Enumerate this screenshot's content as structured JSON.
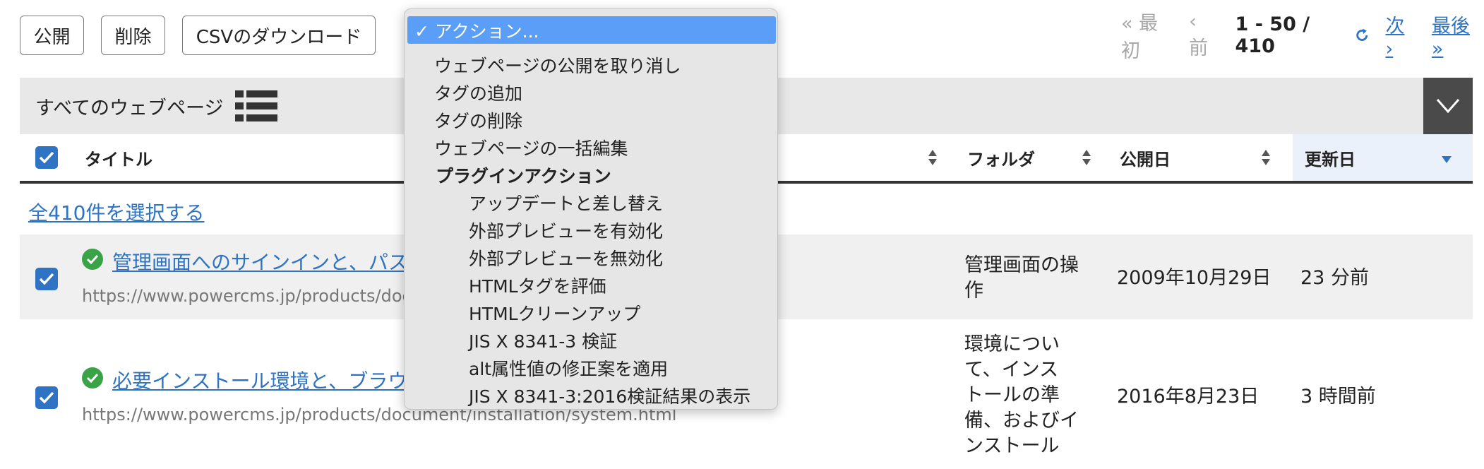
{
  "toolbar": {
    "publish_label": "公開",
    "delete_label": "削除",
    "csv_label": "CSVのダウンロード"
  },
  "pager": {
    "first": "« 最初",
    "prev": "‹ 前",
    "count": "1 - 50 / 410",
    "next": "次 ›",
    "last": "最後 »"
  },
  "listbar": {
    "label": "すべてのウェブページ"
  },
  "table": {
    "headers": {
      "title": "タイトル",
      "folder": "フォルダ",
      "published": "公開日",
      "updated": "更新日"
    },
    "select_all": "全410件を選択する",
    "rows": [
      {
        "title": "管理画面へのサインインと、パス",
        "url": "https://www.powercms.jp/products/docu",
        "folder_lines": [
          "管理画面の操",
          "作"
        ],
        "published": "2009年10月29日",
        "updated": "23 分前"
      },
      {
        "title": "必要インストール環境と、ブラウ",
        "url": "https://www.powercms.jp/products/document/installation/system.html",
        "folder_lines": [
          "環境につい",
          "て、インス",
          "トールの準",
          "備、およびイ",
          "ンストール"
        ],
        "published": "2016年8月23日",
        "updated": "3 時間前"
      }
    ]
  },
  "dropdown": {
    "items": [
      {
        "label": "✓ アクション...",
        "selected": true
      },
      {
        "label": "ウェブページの公開を取り消し"
      },
      {
        "label": "タグの追加"
      },
      {
        "label": "タグの削除"
      },
      {
        "label": "ウェブページの一括編集"
      },
      {
        "label": "プラグインアクション",
        "group": true
      },
      {
        "label": "アップデートと差し替え"
      },
      {
        "label": "外部プレビューを有効化"
      },
      {
        "label": "外部プレビューを無効化"
      },
      {
        "label": "HTMLタグを評価"
      },
      {
        "label": "HTMLクリーンアップ"
      },
      {
        "label": "JIS X 8341-3 検証"
      },
      {
        "label": "alt属性値の修正案を適用"
      },
      {
        "label": "JIS X 8341-3:2016検証結果の表示"
      }
    ]
  },
  "colors": {
    "link": "#2e73c4",
    "selected_option": "#5a9ef7",
    "status_ok": "#3aa348"
  }
}
